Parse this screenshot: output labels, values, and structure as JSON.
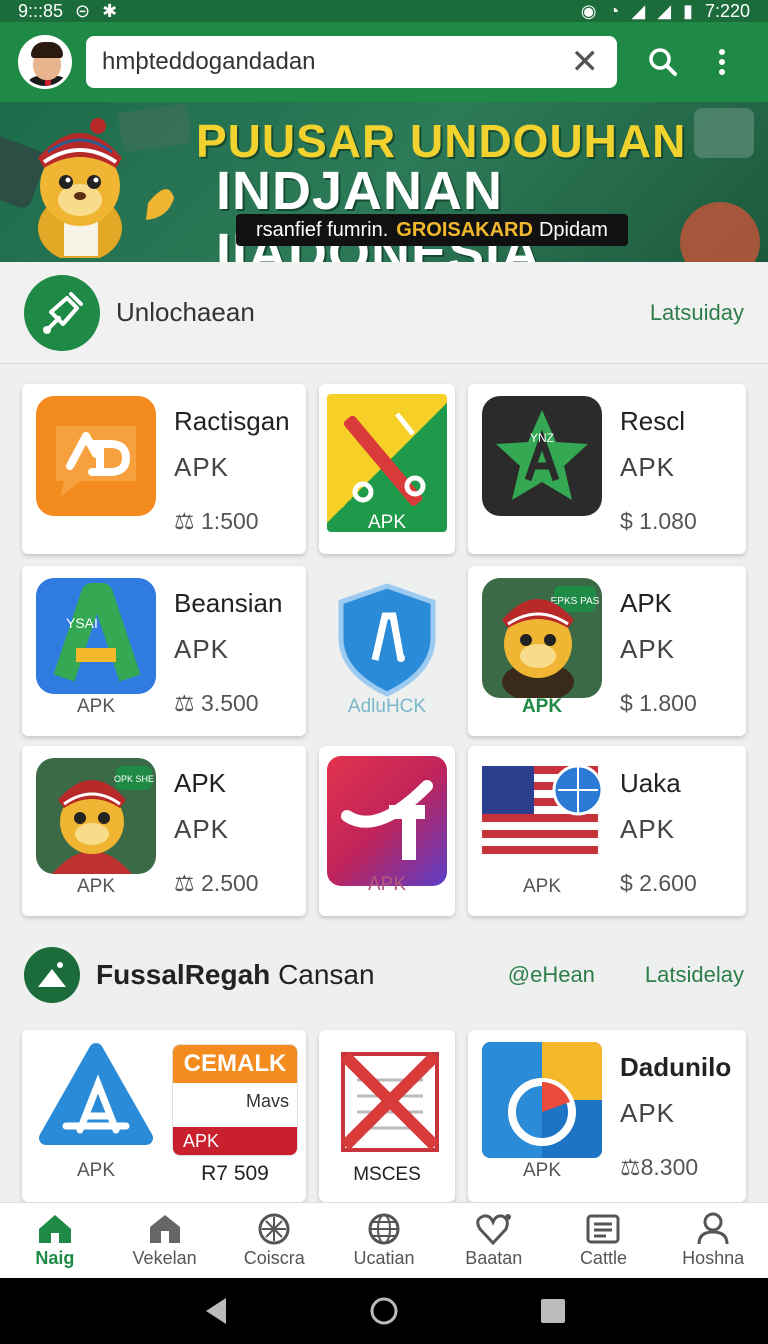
{
  "status_bar": {
    "time_left": "9:::85",
    "time_right": "7:220"
  },
  "search": {
    "value": "hmþteddogandadan"
  },
  "banner": {
    "title_line1": "PUUSAR UNDOUHAN",
    "title_line2": "INDJANAN IIADONESIA",
    "pill_text": "rsanfief fumrin.",
    "pill_accent": "GROISAKARD",
    "pill_end": "Dpidam"
  },
  "section1": {
    "title": "Unlochaean",
    "link": "Latsuiday"
  },
  "section2": {
    "title_bold": "FussalRegah",
    "title_rest": "Cansan",
    "link_a": "@eHean",
    "link_b": "Latsidelay"
  },
  "cards_row1": [
    {
      "name": "Ractisgan",
      "kind": "APK",
      "metric": "⚖ 1:500"
    },
    {
      "sublbl": "APK"
    },
    {
      "name": "Rescl",
      "kind": "APK",
      "metric": "$ 1.080"
    }
  ],
  "cards_row2": [
    {
      "name": "Beansian",
      "kind": "APK",
      "metric": "⚖ 3.500",
      "sublbl": "APK"
    },
    {
      "sublbl": "AdluHCK"
    },
    {
      "name": "APK",
      "kind": "APK",
      "metric": "$ 1.800",
      "sublbl": "APK"
    }
  ],
  "cards_row3": [
    {
      "name": "APK",
      "kind": "APK",
      "metric": "⚖ 2.500",
      "sublbl": "APK"
    },
    {
      "sublbl": "APK"
    },
    {
      "name": "Uaka",
      "kind": "APK",
      "metric": "$ 2.600",
      "sublbl": "APK"
    }
  ],
  "cards_row4": [
    {
      "sublbl": "APK",
      "cemalk": "CEMALK",
      "mavs": "Mavs",
      "apk_tag": "APK",
      "price": "R7 509"
    },
    {
      "sublbl": "MSCES"
    },
    {
      "name": "Dadunilo",
      "kind": "APK",
      "metric": "⚖8.300",
      "sublbl": "APK"
    }
  ],
  "icon_badges": {
    "epk": "EPKS PAS",
    "opk": "OPK SHE",
    "ynz": "YNZ",
    "ysai": "YSAI"
  },
  "bottom_nav": [
    "Naig",
    "Vekelan",
    "Coiscra",
    "Ucatian",
    "Baatan",
    "Cattle",
    "Hoshna"
  ],
  "colors": {
    "primary": "#1f8a45",
    "dark": "#1c6b3a"
  }
}
